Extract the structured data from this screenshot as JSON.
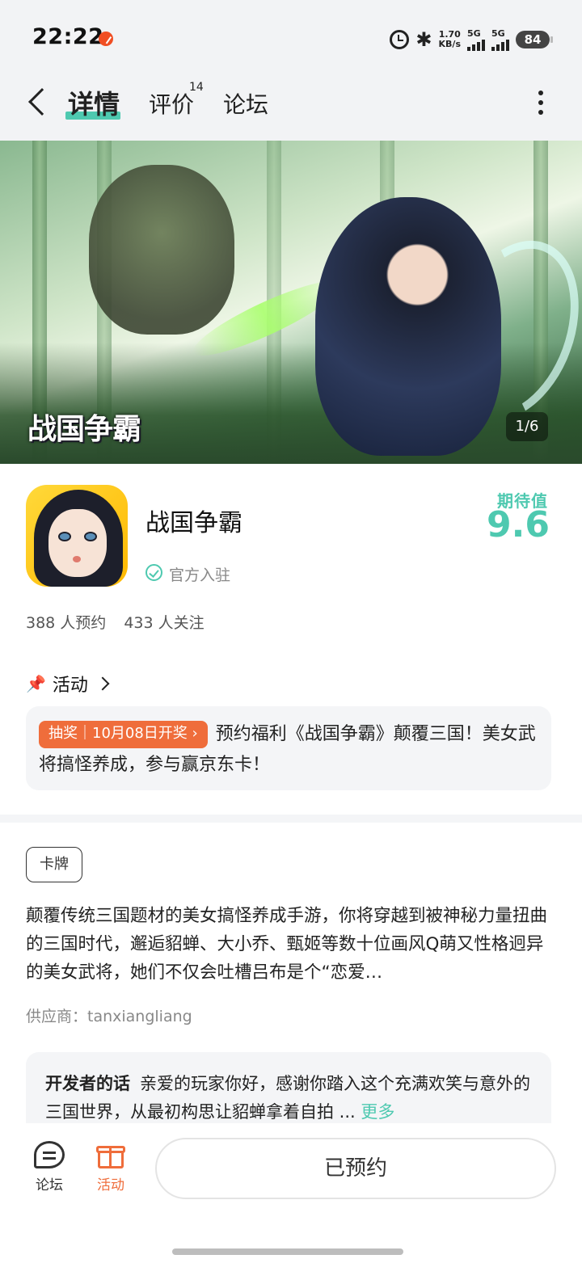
{
  "status_bar": {
    "time": "22:22",
    "net_speed_value": "1.70",
    "net_speed_unit": "KB/s",
    "sim1_label": "5G",
    "sim2_label": "5G",
    "battery": "84"
  },
  "nav": {
    "tabs": [
      {
        "label": "详情",
        "active": true
      },
      {
        "label": "评价",
        "badge": "14"
      },
      {
        "label": "论坛"
      }
    ]
  },
  "banner": {
    "logo_text": "战国争霸",
    "counter": "1/6"
  },
  "game": {
    "title": "战国争霸",
    "official_label": "官方入驻",
    "expect_label": "期待值",
    "expect_score": "9.6",
    "reservations": "388 人预约",
    "followers": "433 人关注"
  },
  "activity": {
    "header": "活动",
    "tag": "抽奖｜10月08日开奖 ›",
    "text": "预约福利《战国争霸》颠覆三国！美女武将搞怪养成，参与赢京东卡！"
  },
  "description": {
    "genre": "卡牌",
    "text": "颠覆传统三国题材的美女搞怪养成手游，你将穿越到被神秘力量扭曲的三国时代，邂逅貂蝉、大小乔、甄姬等数十位画风Q萌又性格迥异的美女武将，她们不仅会吐槽吕布是个“恋爱…",
    "supplier": "供应商：tanxiangliang"
  },
  "developer": {
    "label": "开发者的话",
    "text": "亲爱的玩家你好，感谢你踏入这个充满欢笑与意外的三国世界，从最初构思让貂蝉拿着自拍 ...",
    "more": "更多"
  },
  "bottom_bar": {
    "forum_label": "论坛",
    "activity_label": "活动",
    "reserve_button": "已预约"
  },
  "colors": {
    "accent": "#4ec9b0",
    "lottery": "#ef6d3b",
    "bar_bg": "#f2f3f5"
  }
}
